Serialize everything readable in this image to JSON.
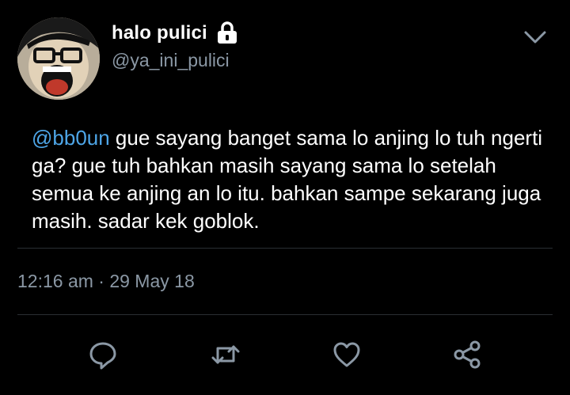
{
  "user": {
    "display_name": "halo pulici",
    "handle": "@ya_ini_pulici",
    "protected_icon": "lock-icon",
    "avatar": "avatar-cartoon-face"
  },
  "tweet": {
    "mention": "@bb0un",
    "text": " gue sayang banget sama lo anjing lo tuh ngerti ga? gue tuh bahkan masih sayang sama lo setelah semua ke anjing an lo itu. bahkan sampe sekarang juga masih. sadar kek goblok.",
    "timestamp": "12:16 am · 29 May 18"
  },
  "actions": [
    {
      "name": "reply",
      "icon": "comment-icon"
    },
    {
      "name": "retweet",
      "icon": "retweet-icon"
    },
    {
      "name": "like",
      "icon": "heart-icon"
    },
    {
      "name": "share",
      "icon": "share-icon"
    }
  ],
  "menu_icon": "chevron-down-icon",
  "colors": {
    "background": "#000000",
    "text": "#ffffff",
    "secondary": "#8b98a5",
    "mention": "#4ea6e8",
    "divider": "#2a2f33"
  }
}
